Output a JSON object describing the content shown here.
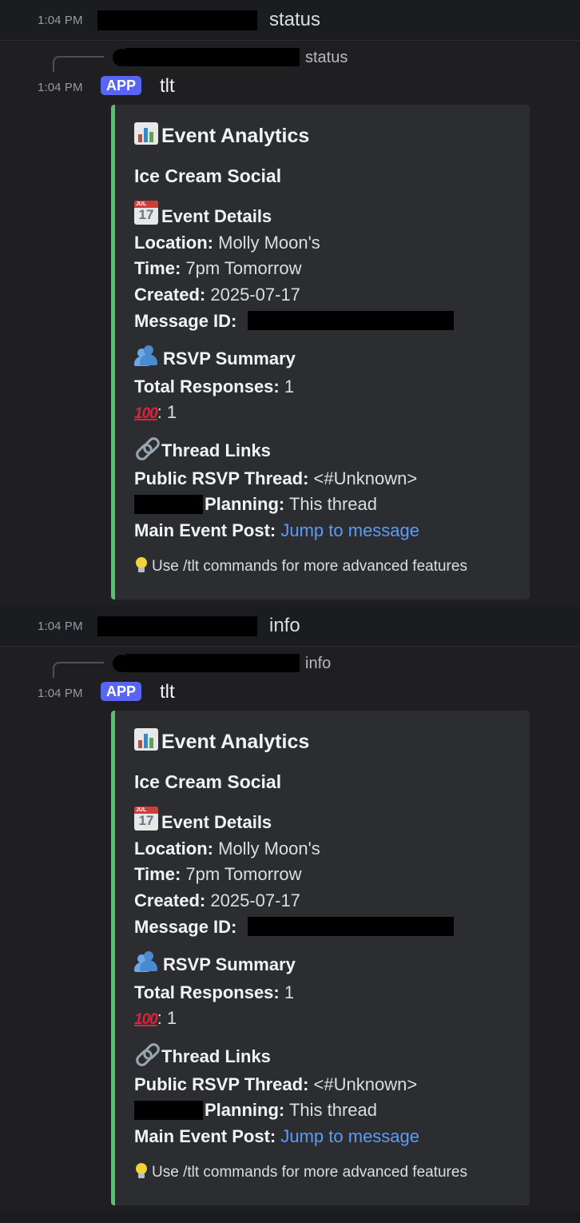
{
  "messages": [
    {
      "command": {
        "timestamp": "1:04 PM",
        "text": "status"
      },
      "reply": {
        "text": "status"
      },
      "response": {
        "timestamp": "1:04 PM",
        "badge": "APP",
        "author": "tlt",
        "embed": {
          "title": "Event Analytics",
          "event_name": "Ice Cream Social",
          "details_heading": "Event Details",
          "location_label": "Location:",
          "location_value": "Molly Moon's",
          "time_label": "Time:",
          "time_value": "7pm Tomorrow",
          "created_label": "Created:",
          "created_value": "2025-07-17",
          "message_id_label": "Message ID:",
          "rsvp_heading": "RSVP Summary",
          "total_label": "Total Responses:",
          "total_value": "1",
          "reaction_emoji": "100",
          "reaction_value": ": 1",
          "threads_heading": "Thread Links",
          "public_label": "Public RSVP Thread:",
          "public_value": "<#Unknown>",
          "planning_label": "Planning:",
          "planning_value": "This thread",
          "main_label": "Main Event Post:",
          "main_link": "Jump to message",
          "footer": "Use /tlt commands for more advanced features"
        }
      }
    },
    {
      "command": {
        "timestamp": "1:04 PM",
        "text": "info"
      },
      "reply": {
        "text": "info"
      },
      "response": {
        "timestamp": "1:04 PM",
        "badge": "APP",
        "author": "tlt",
        "embed": {
          "title": "Event Analytics",
          "event_name": "Ice Cream Social",
          "details_heading": "Event Details",
          "location_label": "Location:",
          "location_value": "Molly Moon's",
          "time_label": "Time:",
          "time_value": "7pm Tomorrow",
          "created_label": "Created:",
          "created_value": "2025-07-17",
          "message_id_label": "Message ID:",
          "rsvp_heading": "RSVP Summary",
          "total_label": "Total Responses:",
          "total_value": "1",
          "reaction_emoji": "100",
          "reaction_value": ": 1",
          "threads_heading": "Thread Links",
          "public_label": "Public RSVP Thread:",
          "public_value": "<#Unknown>",
          "planning_label": "Planning:",
          "planning_value": "This thread",
          "main_label": "Main Event Post:",
          "main_link": "Jump to message",
          "footer": "Use /tlt commands for more advanced features"
        }
      }
    }
  ],
  "colors": {
    "embed_accent": "#57c26d",
    "app_badge": "#5865f2",
    "link": "#5d9bf5",
    "background": "#1f1e21",
    "embed_bg": "#2b2d31"
  }
}
